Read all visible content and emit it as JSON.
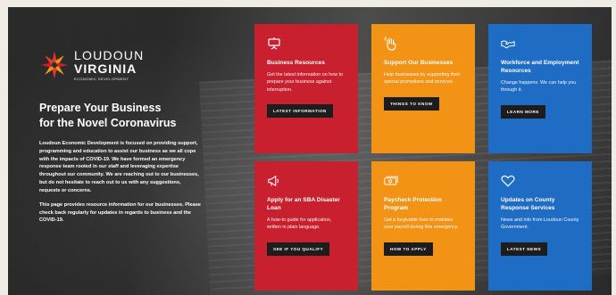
{
  "logo": {
    "line1": "LOUDOUN",
    "line2": "VIRGINIA",
    "line3": "ECONOMIC DEVELOPMENT",
    "colors": [
      "#e23a2a",
      "#f39316",
      "#c8202f"
    ]
  },
  "headline": {
    "line1": "Prepare Your Business",
    "line2": "for the Novel Coronavirus"
  },
  "intro": {
    "p1": "Loudoun Economic Development is focused on providing support, programming and education to assist our business as we all cope with the impacts of COVID-19. We have formed an emergency response team rooted in our staff and leveraging expertise throughout our community. We are reaching out to our businesses, but do not hesitate to reach out to us with any suggestions, requests or concerns.",
    "p2": "This page provides resource information for our businesses. Please check back regularly for updates in regards to business and the COVID-19."
  },
  "cards": [
    {
      "title": "Business Resources",
      "desc": "Get the latest information on how to prepare your business against interruption.",
      "button": "LATEST INFORMATION",
      "icon": "presentation-icon",
      "color": "#c8202f"
    },
    {
      "title": "Support Our Businesses",
      "desc": "Help businesses by supporting their special promotions and services.",
      "button": "THINGS TO KNOW",
      "icon": "waving-hand-icon",
      "color": "#f39316"
    },
    {
      "title": "Workforce and Employment Resources",
      "desc": "Change happens. We can help you through it.",
      "button": "LEARN MORE",
      "icon": "handshake-icon",
      "color": "#1f6cc4"
    },
    {
      "title": "Apply for an SBA Disaster Loan",
      "desc": "A how-to guide for application, written in plain language.",
      "button": "SEE IF YOU QUALIFY",
      "icon": "megaphone-icon",
      "color": "#c8202f"
    },
    {
      "title": "Paycheck Protection Program",
      "desc": "Get a forgivable loan to maintain your payroll during this emergency.",
      "button": "HOW TO APPLY",
      "icon": "money-icon",
      "color": "#f39316"
    },
    {
      "title": "Updates on County Response Services",
      "desc": "News and info from Loudoun County Government.",
      "button": "LATEST NEWS",
      "icon": "heart-icon",
      "color": "#1f6cc4"
    }
  ]
}
